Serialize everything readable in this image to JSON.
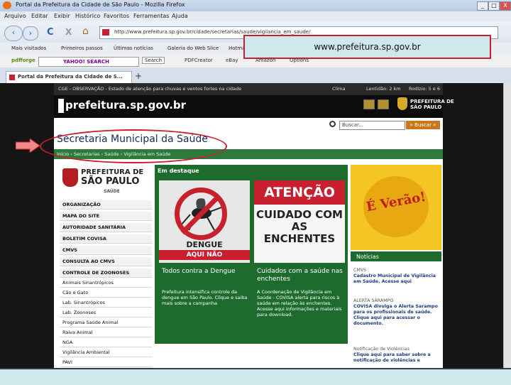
{
  "window": {
    "title": "Portal da Prefeitura da Cidade de São Paulo - Mozilla Firefox",
    "controls": [
      "_",
      "□",
      "X"
    ]
  },
  "menu": [
    "Arquivo",
    "Editar",
    "Exibir",
    "Histórico",
    "Favoritos",
    "Ferramentas",
    "Ajuda"
  ],
  "nav": {
    "back": "‹",
    "forward": "›",
    "reload": "C",
    "stop": "X",
    "home": "⌂",
    "url": "http://www.prefeitura.sp.gov.br/cidade/secretarias/saude/vigilancia_em_saude/"
  },
  "bookmarks": [
    "Mais visitados",
    "Primeiros passos",
    "Últimas notícias",
    "Galeria do Web Slice",
    "Hotmail"
  ],
  "toolbar2": {
    "left": "pdfforge",
    "search_engine": "YAHOO! SEARCH",
    "search_btn": "Search",
    "items": [
      "PDFCreator",
      "eBay",
      "Amazon",
      "Options"
    ]
  },
  "tab": {
    "label": "Portal da Prefeitura da Cidade de S...",
    "new": "+"
  },
  "callout": "www.prefeitura.sp.gov.br",
  "site": {
    "top_strip": "CGE - OBSERVAÇÃO - Estado de atenção para chuvas e ventos fortes na cidade",
    "clima": "Clima",
    "lentidao": "Lentidão: 2 km",
    "rodizio": "Rodízio: 5 e 6",
    "logo": "prefeitura.sp.gov.br",
    "sp_name": [
      "PREFEITURA DE",
      "SÃO PAULO"
    ],
    "search_placeholder": "Buscar...",
    "search_btn": "» Buscar »",
    "page_title": "Secretaria Municipal da Saúde",
    "breadcrumb": "Início › Secretarias › Saúde › Vigilância em Saúde",
    "left_logo": [
      "PREFEITURA DE",
      "SÃO PAULO"
    ],
    "left_logo_sub": "SAÚDE",
    "menu_bold": [
      "ORGANIZAÇÃO",
      "MAPA DO SITE",
      "AUTORIDADE SANITÁRIA",
      "BOLETIM COVISA",
      "CMVS",
      "CONSULTA AO CMVS",
      "CONTROLE DE ZOONOSES"
    ],
    "menu_sub": [
      "Animais Sinantrópicos",
      "Cão e Gato",
      "Lab. Sinantrópicos",
      "Lab. Zoonoses",
      "Programa Saúde Animal",
      "Raiva Animal",
      "NGA",
      "Vigilância Ambiental",
      "PAVI"
    ],
    "destaque_title": "Em destaque",
    "card1": {
      "img_text": "DENGUE",
      "img_sub": "AQUI NÃO",
      "title": "Todos contra a Dengue",
      "body": "Prefeitura intensifica controle da dengue em São Paulo. Clique e saiba mais sobre a campanha"
    },
    "card2": {
      "img_head": "ATENÇÃO",
      "img_text": "CUIDADO COM AS ENCHENTES",
      "title": "Cuidados com a saúde nas enchentes",
      "body": "A Coordenação de Vigilância em Saúde - COVISA alerta para riscos à saúde em relação às enchentes. Acesse aqui informações e materiais para download."
    },
    "verao_text": "É Verão!",
    "noticias_title": "Notícias",
    "news": [
      {
        "head": "CMVS",
        "text": "Cadastro Municipal de Vigilância em Saúde. Acesse aqui"
      },
      {
        "head": "ALERTA SARAMPO",
        "text": "COVISA divulga o Alerta Sarampo para os profissionais de saúde. Clique aqui para acessar o documento."
      },
      {
        "head": "Notificação de Violências",
        "text": "Clique aqui para saber sobre a notificação de violências e"
      }
    ]
  }
}
